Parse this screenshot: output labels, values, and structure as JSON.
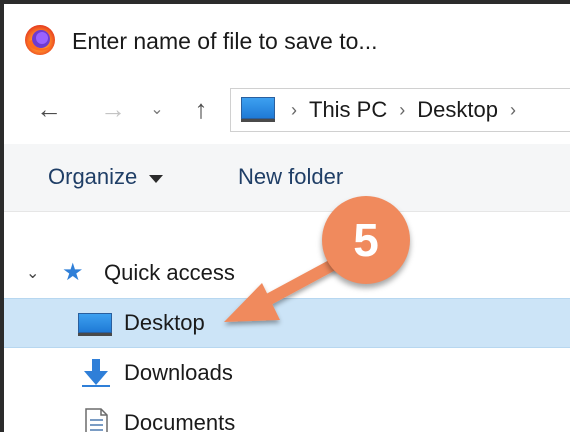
{
  "window": {
    "title": "Enter name of file to save to..."
  },
  "nav": {
    "back_icon": "←",
    "forward_icon": "→",
    "recent_icon": "⌄",
    "up_icon": "↑"
  },
  "address": {
    "breadcrumbs": [
      "This PC",
      "Desktop"
    ],
    "separator": "›"
  },
  "toolbar": {
    "organize_label": "Organize",
    "new_folder_label": "New folder"
  },
  "tree": {
    "quick_access": "Quick access",
    "expander": "⌄",
    "items": [
      {
        "label": "Desktop",
        "icon": "desktop-icon",
        "selected": true
      },
      {
        "label": "Downloads",
        "icon": "downloads-icon",
        "selected": false
      },
      {
        "label": "Documents",
        "icon": "documents-icon",
        "selected": false
      }
    ]
  },
  "annotation": {
    "step": "5",
    "color": "#f08a5d"
  },
  "colors": {
    "selection": "#cce4f7",
    "accent": "#2f7fd8",
    "toolbar_text": "#1f3e66"
  }
}
